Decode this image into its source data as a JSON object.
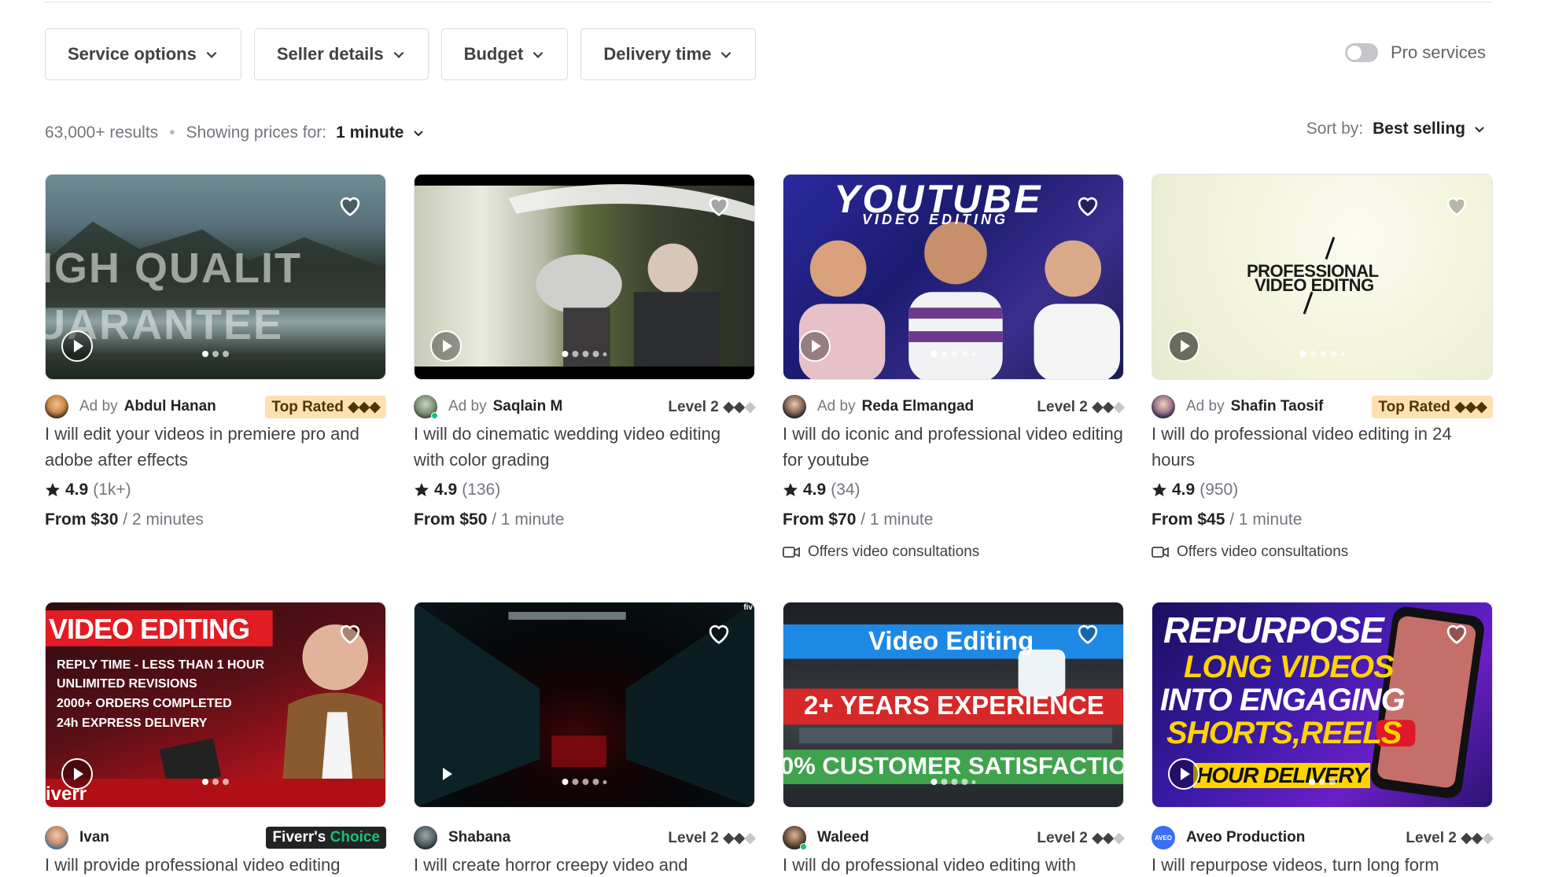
{
  "filters": [
    {
      "label": "Service options"
    },
    {
      "label": "Seller details"
    },
    {
      "label": "Budget"
    },
    {
      "label": "Delivery time"
    }
  ],
  "pro_services": {
    "label": "Pro services",
    "enabled": false
  },
  "results": {
    "count": "63,000+ results",
    "showing_label": "Showing prices for:",
    "showing_value": "1 minute"
  },
  "sort": {
    "label": "Sort by:",
    "value": "Best selling"
  },
  "colors": {
    "accent_green": "#1dbf73",
    "top_rated_bg": "#ffe0b3",
    "text_muted": "#74767e"
  },
  "gigs": [
    {
      "thumb_caption": [
        "IGH QUALIT",
        "UARANTEE"
      ],
      "ad": true,
      "ad_label": "Ad by",
      "seller": "Abdul Hanan",
      "badge": {
        "type": "top",
        "text": "Top Rated",
        "diamonds": "◆◆◆"
      },
      "title": "I will edit your videos in premiere pro and adobe after effects",
      "rating": "4.9",
      "reviews": "(1k+)",
      "price": "From $30",
      "per": "/ 2 minutes",
      "consult": ""
    },
    {
      "thumb_caption": [],
      "ad": true,
      "ad_label": "Ad by",
      "seller": "Saqlain M",
      "badge": {
        "type": "level",
        "text": "Level 2",
        "diamonds": "◆◆",
        "off": "◆"
      },
      "title": "I will do cinematic wedding video editing with color grading",
      "rating": "4.9",
      "reviews": "(136)",
      "price": "From $50",
      "per": "/ 1 minute",
      "consult": ""
    },
    {
      "thumb_caption": [
        "YOUTUBE",
        "VIDEO EDITING"
      ],
      "ad": true,
      "ad_label": "Ad by",
      "seller": "Reda Elmangad",
      "badge": {
        "type": "level",
        "text": "Level 2",
        "diamonds": "◆◆",
        "off": "◆"
      },
      "title": "I will do iconic and professional video editing for youtube",
      "rating": "4.9",
      "reviews": "(34)",
      "price": "From $70",
      "per": "/ 1 minute",
      "consult": "Offers video consultations"
    },
    {
      "thumb_caption": [
        "PROFESSIONAL",
        "VIDEO EDITNG"
      ],
      "ad": true,
      "ad_label": "Ad by",
      "seller": "Shafin Taosif",
      "badge": {
        "type": "top",
        "text": "Top Rated",
        "diamonds": "◆◆◆"
      },
      "title": "I will do professional video editing in 24 hours",
      "rating": "4.9",
      "reviews": "(950)",
      "price": "From $45",
      "per": "/ 1 minute",
      "consult": "Offers video consultations"
    },
    {
      "thumb_caption": [
        "VIDEO EDITING",
        "REPLY TIME - LESS THAN 1 HOUR",
        "UNLIMITED REVISIONS",
        "2000+ ORDERS COMPLETED",
        "24h EXPRESS DELIVERY",
        "iverr"
      ],
      "ad": false,
      "seller": "Ivan",
      "badge": {
        "type": "choice",
        "text": "Fiverr's",
        "text2": "Choice"
      },
      "title": "I will provide professional video editing"
    },
    {
      "thumb_caption": [
        "fiv"
      ],
      "ad": false,
      "seller": "Shabana",
      "badge": {
        "type": "level",
        "text": "Level 2",
        "diamonds": "◆◆",
        "off": "◆"
      },
      "title": "I will create horror creepy video and"
    },
    {
      "thumb_caption": [
        "Video Editing",
        "2+ YEARS EXPERIENCE",
        "0% CUSTOMER SATISFACTIO"
      ],
      "ad": false,
      "seller": "Waleed",
      "badge": {
        "type": "level",
        "text": "Level 2",
        "diamonds": "◆◆",
        "off": "◆"
      },
      "title": "I will do professional video editing with"
    },
    {
      "thumb_caption": [
        "REPURPOSE",
        "LONG VIDEOS",
        "INTO ENGAGING",
        "SHORTS,REELS",
        "HOUR DELIVERY",
        "AVEO"
      ],
      "ad": false,
      "seller": "Aveo Production",
      "badge": {
        "type": "level",
        "text": "Level 2",
        "diamonds": "◆◆",
        "off": "◆"
      },
      "title": "I will repurpose videos, turn long form"
    }
  ]
}
